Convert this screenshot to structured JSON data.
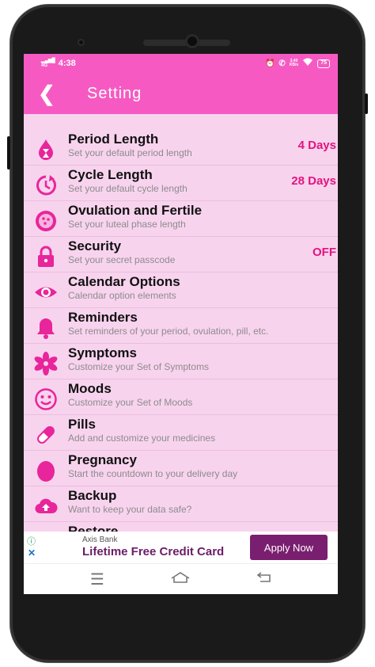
{
  "status_bar": {
    "signal": "4G",
    "time": "4:38",
    "speed_top": "3.40",
    "speed_bottom": "KB/s",
    "battery": "75",
    "alarm_icon": "alarm-icon",
    "call_icon": "wifi-call-icon",
    "wifi_icon": "wifi-icon"
  },
  "app_bar": {
    "back_icon": "back-arrow-icon",
    "title": "Setting"
  },
  "settings": [
    {
      "key": "period-length",
      "icon": "drop-hourglass-icon",
      "title": "Period Length",
      "subtitle": "Set your default period length",
      "value": "4 Days"
    },
    {
      "key": "cycle-length",
      "icon": "clock-cycle-icon",
      "title": "Cycle Length",
      "subtitle": "Set your default cycle length",
      "value": "28 Days"
    },
    {
      "key": "ovulation",
      "icon": "egg-cell-icon",
      "title": "Ovulation and Fertile",
      "subtitle": "Set your luteal phase length",
      "value": ""
    },
    {
      "key": "security",
      "icon": "lock-icon",
      "title": "Security",
      "subtitle": "Set your secret passcode",
      "value": "OFF"
    },
    {
      "key": "calendar-options",
      "icon": "eye-icon",
      "title": "Calendar Options",
      "subtitle": "Calendar option elements",
      "value": ""
    },
    {
      "key": "reminders",
      "icon": "bell-icon",
      "title": "Reminders",
      "subtitle": "Set reminders of your period, ovulation, pill, etc.",
      "value": ""
    },
    {
      "key": "symptoms",
      "icon": "asterisk-flower-icon",
      "title": "Symptoms",
      "subtitle": "Customize your Set of Symptoms",
      "value": ""
    },
    {
      "key": "moods",
      "icon": "smiley-icon",
      "title": "Moods",
      "subtitle": "Customize your Set of Moods",
      "value": ""
    },
    {
      "key": "pills",
      "icon": "pill-icon",
      "title": "Pills",
      "subtitle": "Add and customize your medicines",
      "value": ""
    },
    {
      "key": "pregnancy",
      "icon": "egg-icon",
      "title": "Pregnancy",
      "subtitle": "Start the countdown to your delivery day",
      "value": ""
    },
    {
      "key": "backup",
      "icon": "cloud-upload-icon",
      "title": "Backup",
      "subtitle": "Want to keep your data safe?",
      "value": ""
    },
    {
      "key": "restore",
      "icon": "restore-icon",
      "title": "Restore",
      "subtitle": "",
      "value": ""
    }
  ],
  "ad": {
    "info_icon": "info-icon",
    "close_icon": "close-icon",
    "brand": "Axis Bank",
    "title": "Lifetime Free Credit Card",
    "button": "Apply Now"
  },
  "nav_bar": {
    "menu_icon": "menu-icon",
    "home_icon": "home-icon",
    "back_icon": "back-icon"
  },
  "colors": {
    "primary": "#f65ac2",
    "background": "#f8d3ee",
    "icon": "#e8259a",
    "value": "#e0157f",
    "ad_button": "#7a1f6f"
  }
}
